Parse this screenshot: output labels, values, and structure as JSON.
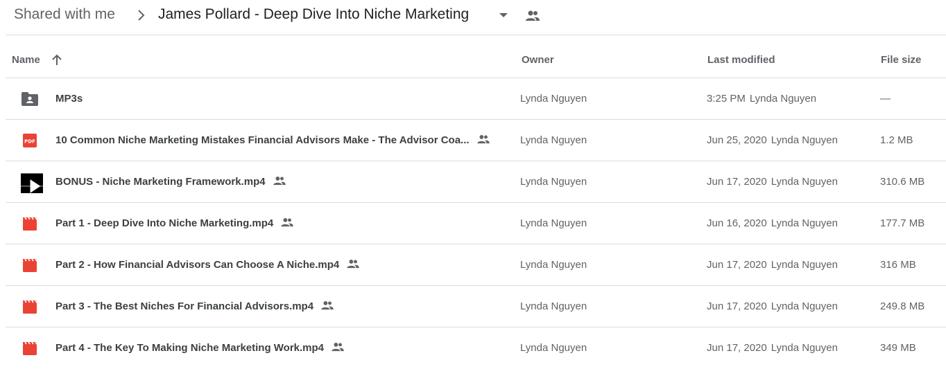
{
  "breadcrumb": {
    "root": "Shared with me",
    "current": "James Pollard - Deep Dive Into Niche Marketing"
  },
  "columns": {
    "name": "Name",
    "owner": "Owner",
    "modified": "Last modified",
    "size": "File size"
  },
  "files": [
    {
      "name": "MP3s",
      "type": "shared-folder",
      "shared": false,
      "owner": "Lynda Nguyen",
      "modified": "3:25 PM",
      "modified_by": "Lynda Nguyen",
      "size": "—"
    },
    {
      "name": "10 Common Niche Marketing Mistakes Financial Advisors Make - The Advisor Coa...",
      "type": "pdf",
      "shared": true,
      "owner": "Lynda Nguyen",
      "modified": "Jun 25, 2020",
      "modified_by": "Lynda Nguyen",
      "size": "1.2 MB"
    },
    {
      "name": "BONUS - Niche Marketing Framework.mp4",
      "type": "video-thumbnail",
      "shared": true,
      "owner": "Lynda Nguyen",
      "modified": "Jun 17, 2020",
      "modified_by": "Lynda Nguyen",
      "size": "310.6 MB"
    },
    {
      "name": "Part 1 - Deep Dive Into Niche Marketing.mp4",
      "type": "video",
      "shared": true,
      "owner": "Lynda Nguyen",
      "modified": "Jun 16, 2020",
      "modified_by": "Lynda Nguyen",
      "size": "177.7 MB"
    },
    {
      "name": "Part 2 - How Financial Advisors Can Choose A Niche.mp4",
      "type": "video",
      "shared": true,
      "owner": "Lynda Nguyen",
      "modified": "Jun 17, 2020",
      "modified_by": "Lynda Nguyen",
      "size": "316 MB"
    },
    {
      "name": "Part 3 - The Best Niches For Financial Advisors.mp4",
      "type": "video",
      "shared": true,
      "owner": "Lynda Nguyen",
      "modified": "Jun 17, 2020",
      "modified_by": "Lynda Nguyen",
      "size": "249.8 MB"
    },
    {
      "name": "Part 4 - The Key To Making Niche Marketing Work.mp4",
      "type": "video",
      "shared": true,
      "owner": "Lynda Nguyen",
      "modified": "Jun 17, 2020",
      "modified_by": "Lynda Nguyen",
      "size": "349 MB"
    }
  ],
  "colors": {
    "text": "#3c4043",
    "muted": "#5f6368",
    "divider": "#dadce0",
    "pdf_red": "#ea4335",
    "video_red": "#ea4335"
  }
}
